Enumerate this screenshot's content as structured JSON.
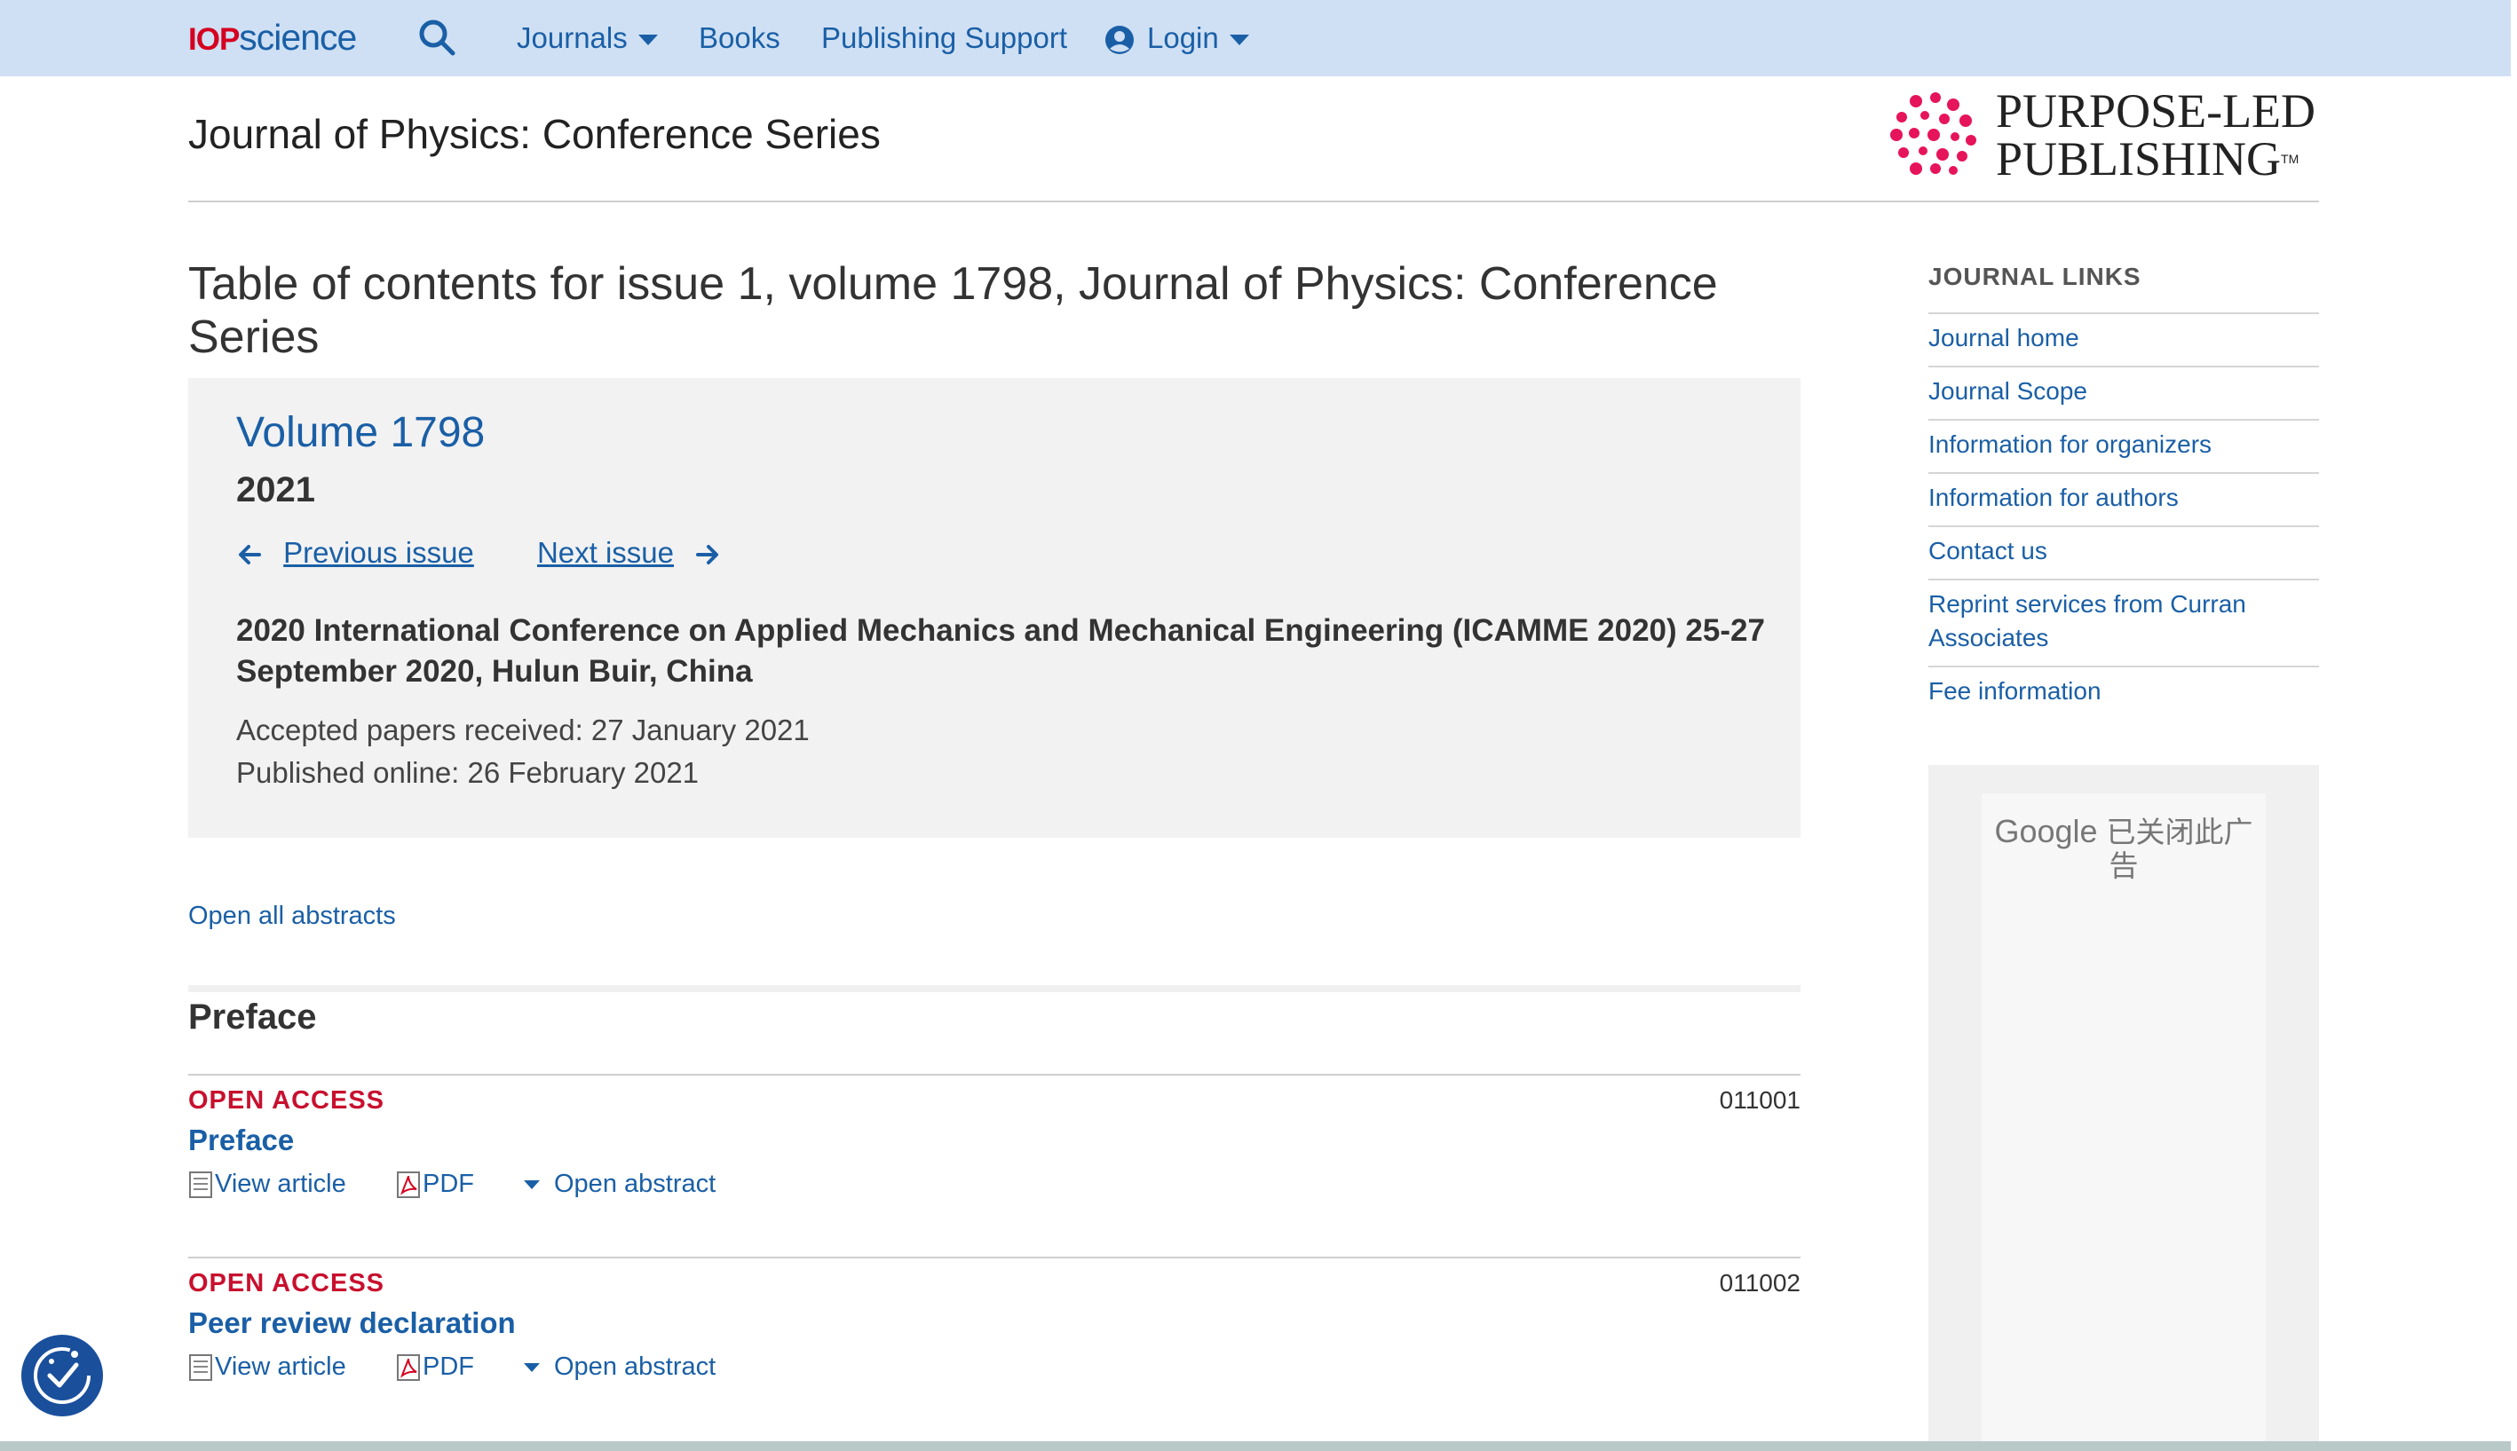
{
  "header": {
    "logo_iop": "IOP",
    "logo_science": "science",
    "nav": [
      {
        "label": "Journals"
      },
      {
        "label": "Books"
      },
      {
        "label": "Publishing Support"
      },
      {
        "label": "Login"
      }
    ]
  },
  "journal_title": "Journal of Physics: Conference Series",
  "publisher_logo": {
    "line1": "PURPOSE-LED",
    "line2": "PUBLISHING",
    "tm": "TM"
  },
  "toc_heading": "Table of contents for issue 1, volume 1798, Journal of Physics: Conference Series",
  "volume": {
    "title": "Volume 1798",
    "year": "2021",
    "prev_label": "Previous issue",
    "next_label": "Next issue",
    "conference": "2020 International Conference on Applied Mechanics and Mechanical Engineering (ICAMME 2020) 25-27 September 2020, Hulun Buir, China",
    "accepted": "Accepted papers received: 27 January 2021",
    "published": "Published online: 26 February 2021"
  },
  "open_all_abstracts": "Open all abstracts",
  "section_title": "Preface",
  "articles": [
    {
      "access": "OPEN ACCESS",
      "number": "011001",
      "title": "Preface",
      "view": "View article",
      "pdf": "PDF",
      "abstract": "Open abstract"
    },
    {
      "access": "OPEN ACCESS",
      "number": "011002",
      "title": "Peer review declaration",
      "view": "View article",
      "pdf": "PDF",
      "abstract": "Open abstract"
    }
  ],
  "journal_links": {
    "title": "JOURNAL LINKS",
    "items": [
      "Journal home",
      "Journal Scope",
      "Information for organizers",
      "Information for authors",
      "Contact us",
      "Reprint services from Curran Associates",
      "Fee information"
    ]
  },
  "ad": {
    "brand": "Google",
    "message": "已关闭此广告"
  },
  "colors": {
    "link": "#1a5fa6",
    "open_access": "#c8102e",
    "topbar": "#cfe0f4",
    "brand_red": "#d5001f",
    "ppl_pink": "#e6145a"
  }
}
